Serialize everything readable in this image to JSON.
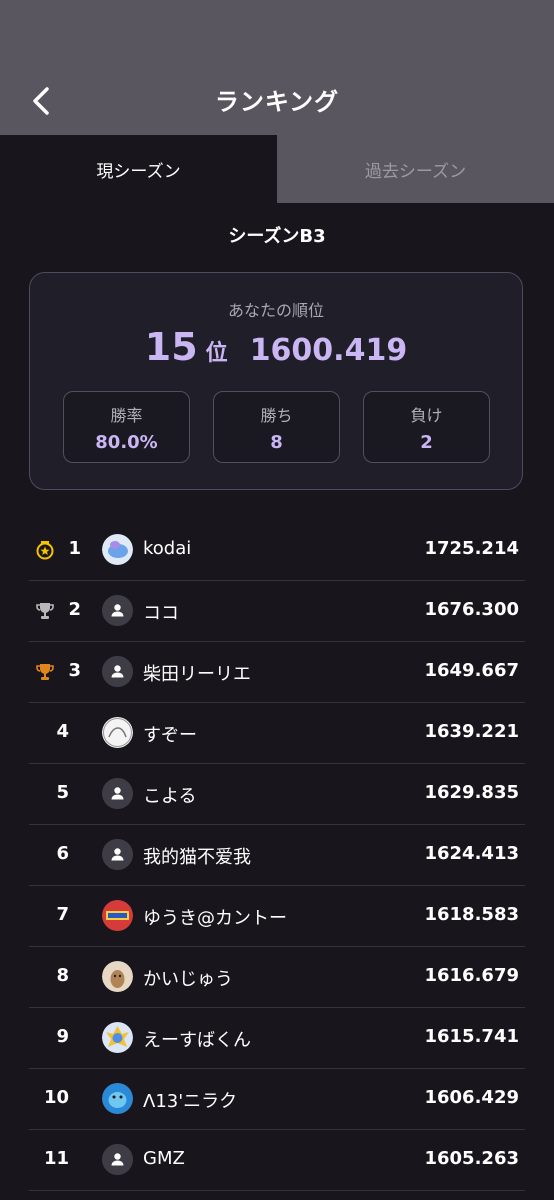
{
  "header": {
    "title": "ランキング",
    "back_icon": "chevron-left-icon"
  },
  "tabs": [
    {
      "label": "現シーズン",
      "active": true
    },
    {
      "label": "過去シーズン",
      "active": false
    }
  ],
  "season": {
    "title": "シーズンB3"
  },
  "my_rank": {
    "label": "あなたの順位",
    "rank": "15",
    "rank_unit": "位",
    "score": "1600.419",
    "stats": [
      {
        "label": "勝率",
        "value": "80.0%"
      },
      {
        "label": "勝ち",
        "value": "8"
      },
      {
        "label": "負け",
        "value": "2"
      }
    ]
  },
  "ranking": [
    {
      "rank": "1",
      "name": "kodai",
      "score": "1725.214",
      "medal": "gold",
      "avatar": "photo-blue"
    },
    {
      "rank": "2",
      "name": "ココ",
      "score": "1676.300",
      "medal": "silver",
      "avatar": "default"
    },
    {
      "rank": "3",
      "name": "柴田リーリエ",
      "score": "1649.667",
      "medal": "bronze",
      "avatar": "default"
    },
    {
      "rank": "4",
      "name": "すぞー",
      "score": "1639.221",
      "medal": "",
      "avatar": "photo-white"
    },
    {
      "rank": "5",
      "name": "こよる",
      "score": "1629.835",
      "medal": "",
      "avatar": "default"
    },
    {
      "rank": "6",
      "name": "我的猫不爱我",
      "score": "1624.413",
      "medal": "",
      "avatar": "default"
    },
    {
      "rank": "7",
      "name": "ゆうき@カントー",
      "score": "1618.583",
      "medal": "",
      "avatar": "photo-red"
    },
    {
      "rank": "8",
      "name": "かいじゅう",
      "score": "1616.679",
      "medal": "",
      "avatar": "photo-tan"
    },
    {
      "rank": "9",
      "name": "えーすばくん",
      "score": "1615.741",
      "medal": "",
      "avatar": "photo-yellow"
    },
    {
      "rank": "10",
      "name": "Λ13'ニラク",
      "score": "1606.429",
      "medal": "",
      "avatar": "photo-cyan"
    },
    {
      "rank": "11",
      "name": "GMZ",
      "score": "1605.263",
      "medal": "",
      "avatar": "default"
    }
  ],
  "colors": {
    "header_bg": "#5a5660",
    "page_bg": "#18161c",
    "accent": "#c9b6f2",
    "gold": "#f2c400",
    "silver": "#b8b8b8",
    "bronze": "#e0861c"
  }
}
